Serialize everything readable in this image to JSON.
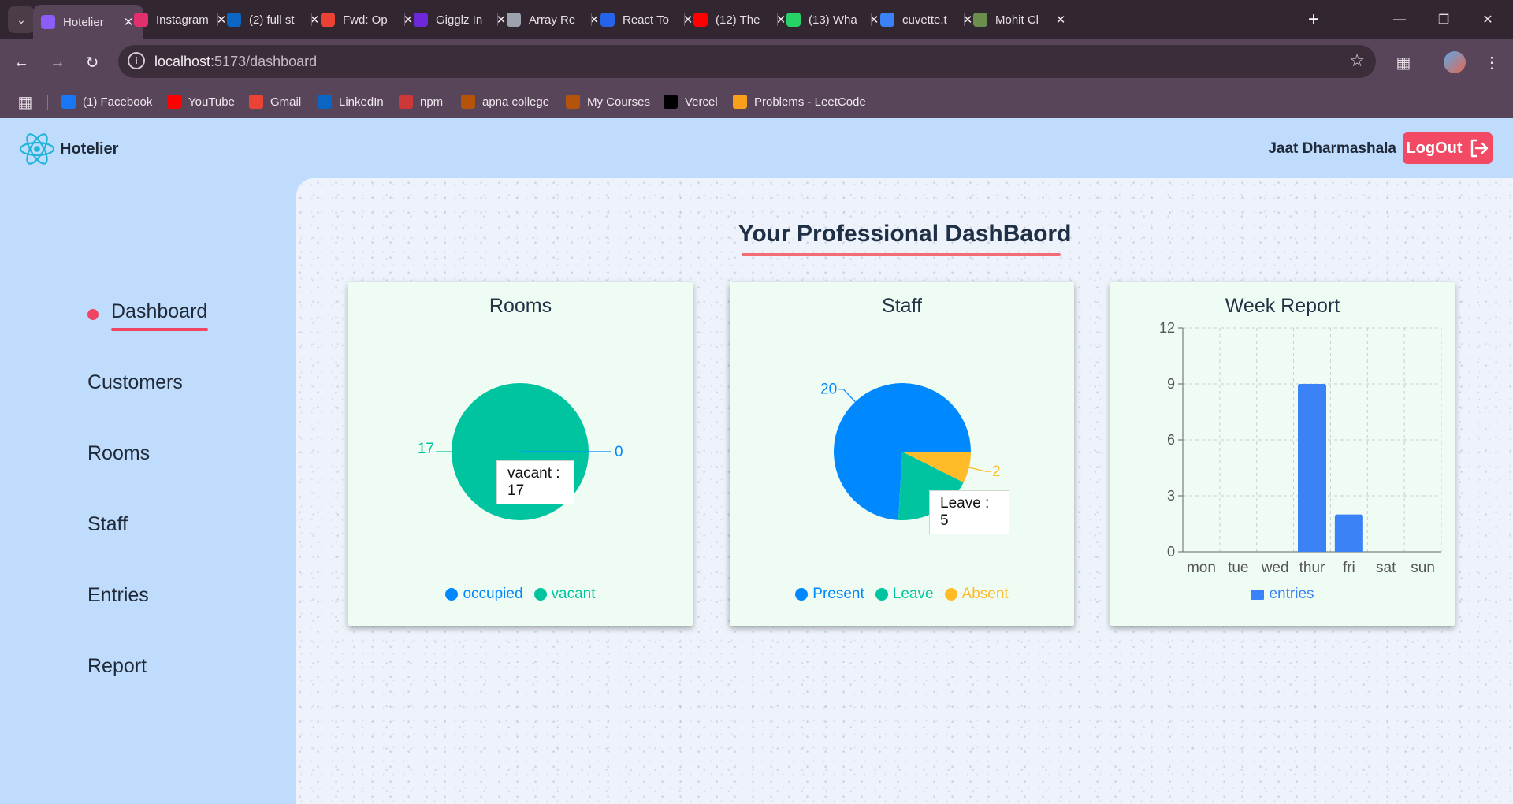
{
  "browser": {
    "tabs": [
      {
        "title": "Hotelier",
        "icon": "vite-icon",
        "color": "#8b5cf6",
        "active": true
      },
      {
        "title": "Instagram",
        "icon": "instagram-icon",
        "color": "#e1306c"
      },
      {
        "title": "(2) full st",
        "icon": "linkedin-icon",
        "color": "#0a66c2"
      },
      {
        "title": "Fwd: Op",
        "icon": "gmail-icon",
        "color": "#ea4335"
      },
      {
        "title": "Gigglz In",
        "icon": "list-icon",
        "color": "#6d28d9"
      },
      {
        "title": "Array Re",
        "icon": "openai-icon",
        "color": "#9ca3af"
      },
      {
        "title": "React To",
        "icon": "react-icon",
        "color": "#2563eb"
      },
      {
        "title": "(12) The",
        "icon": "youtube-icon",
        "color": "#ff0000"
      },
      {
        "title": "(13) Wha",
        "icon": "whatsapp-icon",
        "color": "#25d366"
      },
      {
        "title": "cuvette.t",
        "icon": "cuvette-icon",
        "color": "#3b82f6"
      },
      {
        "title": "Mohit Cl",
        "icon": "image-icon",
        "color": "#6b8e4e"
      }
    ],
    "url_host": "localhost",
    "url_path": ":5173/dashboard",
    "bookmarks": [
      {
        "label": "(1) Facebook",
        "icon": "facebook-icon",
        "color": "#1877f2"
      },
      {
        "label": "YouTube",
        "icon": "youtube-icon",
        "color": "#ff0000"
      },
      {
        "label": "Gmail",
        "icon": "gmail-icon",
        "color": "#ea4335"
      },
      {
        "label": "LinkedIn",
        "icon": "linkedin-icon",
        "color": "#0a66c2"
      },
      {
        "label": "npm",
        "icon": "npm-icon",
        "color": "#cb3837"
      },
      {
        "label": "apna college",
        "icon": "apna-college-icon",
        "color": "#b45309"
      },
      {
        "label": "My Courses",
        "icon": "apna-college-icon",
        "color": "#b45309"
      },
      {
        "label": "Vercel",
        "icon": "vercel-icon",
        "color": "#000000"
      },
      {
        "label": "Problems - LeetCode",
        "icon": "leetcode-icon",
        "color": "#f89f1b"
      }
    ]
  },
  "header": {
    "brand": "Hotelier",
    "user_name": "Jaat Dharmashala",
    "logout_label": "LogOut"
  },
  "sidebar": {
    "items": [
      {
        "label": "Dashboard",
        "active": true
      },
      {
        "label": "Customers"
      },
      {
        "label": "Rooms"
      },
      {
        "label": "Staff"
      },
      {
        "label": "Entries"
      },
      {
        "label": "Report"
      }
    ]
  },
  "main": {
    "title": "Your Professional DashBaord"
  },
  "colors": {
    "accent": "#ef4562",
    "blue": "#0088fe",
    "green": "#00c49f",
    "yellow": "#ffbb28",
    "bar": "#3b82f6"
  },
  "chart_data": [
    {
      "type": "pie",
      "title": "Rooms",
      "series": [
        {
          "name": "occupied",
          "value": 0,
          "color": "#0088fe"
        },
        {
          "name": "vacant",
          "value": 17,
          "color": "#00c49f"
        }
      ],
      "tooltip": "vacant : 17",
      "legend": "bottom"
    },
    {
      "type": "pie",
      "title": "Staff",
      "series": [
        {
          "name": "Present",
          "value": 20,
          "color": "#0088fe"
        },
        {
          "name": "Leave",
          "value": 5,
          "color": "#00c49f"
        },
        {
          "name": "Absent",
          "value": 2,
          "color": "#ffbb28"
        }
      ],
      "tooltip": "Leave : 5",
      "legend": "bottom"
    },
    {
      "type": "bar",
      "title": "Week Report",
      "categories": [
        "mon",
        "tue",
        "wed",
        "thur",
        "fri",
        "sat",
        "sun"
      ],
      "series": [
        {
          "name": "entries",
          "values": [
            0,
            0,
            0,
            9,
            2,
            0,
            0
          ],
          "color": "#3b82f6"
        }
      ],
      "ylim": [
        0,
        12
      ],
      "yticks": [
        0,
        3,
        6,
        9,
        12
      ],
      "grid": true,
      "legend": "bottom"
    }
  ]
}
